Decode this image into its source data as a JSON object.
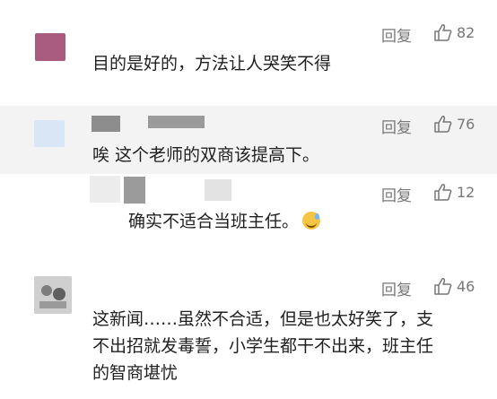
{
  "colors": {
    "text": "#1f1f1f",
    "meta": "#777777",
    "band": "#f3f3f3",
    "avatar_1": "#a95c7e",
    "avatar_2": "#d9e6f5"
  },
  "comments": [
    {
      "text": "目的是好的，方法让人哭笑不得",
      "reply": "回复",
      "likes": "82"
    },
    {
      "text": "唉  这个老师的双商该提高下。",
      "reply": "回复",
      "likes": "76"
    },
    {
      "text": "确实不适合当班主任。",
      "emoji": "sweat-smile-emoji",
      "reply": "回复",
      "likes": "12"
    },
    {
      "lines": [
        "这新闻……虽然不合适，但是也太好笑了，支",
        "不出招就发毒誓，小学生都干不出来，班主任",
        "的智商堪忧"
      ],
      "reply": "回复",
      "likes": "46"
    }
  ],
  "icons": {
    "like": "thumbs-up-icon",
    "avatar_blur": "pixelated-avatar"
  }
}
